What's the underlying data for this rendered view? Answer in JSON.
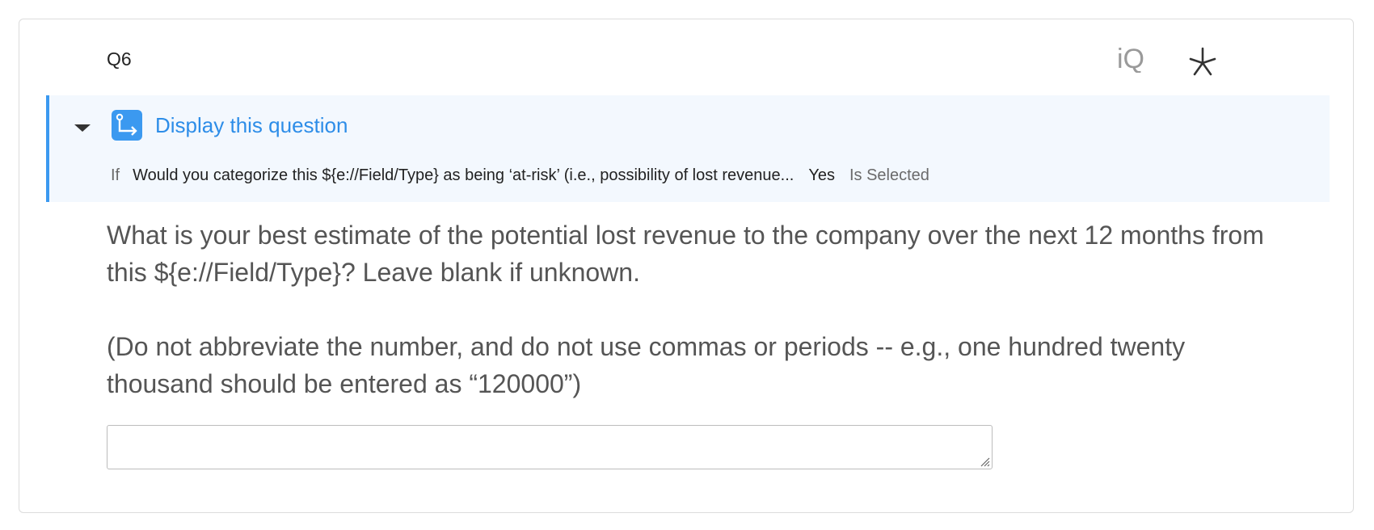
{
  "question": {
    "id": "Q6",
    "iq_label": "iQ",
    "body_paragraphs": [
      "What is your best estimate of the potential lost revenue to the company over the next 12 months from this ${e://Field/Type}? Leave blank if unknown.",
      "(Do not abbreviate the number, and do not use commas or periods -- e.g., one hundred twenty thousand should be entered as “120000”)"
    ],
    "answer_value": ""
  },
  "display_logic": {
    "title": "Display this question",
    "condition": {
      "if_label": "If",
      "question": "Would you categorize this ${e://Field/Type} as being ‘at-risk’ (i.e., possibility of lost revenue...",
      "answer": "Yes",
      "operator": "Is Selected"
    }
  },
  "icons": {
    "toggle": "caret-down-icon",
    "logic": "display-logic-icon",
    "iq": "iq-icon",
    "required": "asterisk-icon"
  },
  "colors": {
    "accent": "#3b99f0",
    "link": "#2d8de8",
    "panel_bg": "#f3f8fe",
    "icon_gray": "#9a9a9a"
  }
}
